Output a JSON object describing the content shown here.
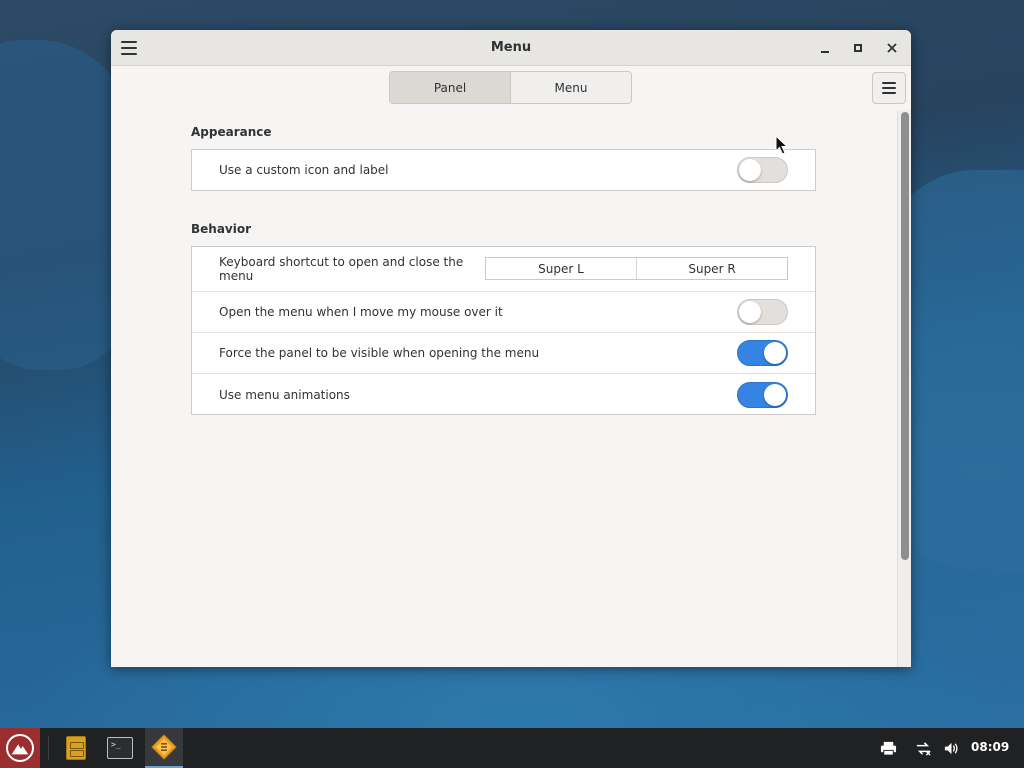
{
  "window": {
    "title": "Menu",
    "tabs": [
      {
        "label": "Panel",
        "active": true
      },
      {
        "label": "Menu",
        "active": false
      }
    ]
  },
  "appearance": {
    "title": "Appearance",
    "rows": [
      {
        "label": "Use a custom icon and label",
        "toggle": false
      }
    ]
  },
  "behavior": {
    "title": "Behavior",
    "shortcut": {
      "label": "Keyboard shortcut to open and close the menu",
      "options": [
        "Super L",
        "Super R"
      ]
    },
    "rows": [
      {
        "label": "Open the menu when I move my mouse over it",
        "toggle": false
      },
      {
        "label": "Force the panel to be visible when opening the menu",
        "toggle": true
      },
      {
        "label": "Use menu animations",
        "toggle": true
      }
    ]
  },
  "taskbar": {
    "clock": "08:09"
  },
  "colors": {
    "accent": "#3584e4",
    "start_button": "#9b2f2f",
    "taskbar": "#1f2122"
  },
  "icons": [
    "hamburger-icon",
    "minimize-icon",
    "maximize-icon",
    "close-icon",
    "start-menu-icon",
    "file-manager-icon",
    "terminal-icon",
    "menu-app-icon",
    "printer-icon",
    "network-icon",
    "volume-icon",
    "mouse-cursor-icon"
  ]
}
